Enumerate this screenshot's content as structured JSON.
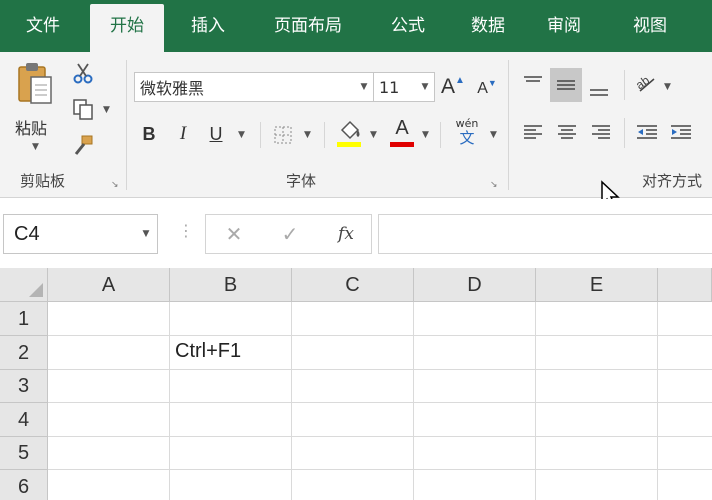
{
  "tabs": [
    "文件",
    "开始",
    "插入",
    "页面布局",
    "公式",
    "数据",
    "审阅",
    "视图"
  ],
  "active_tab": "开始",
  "clipboard": {
    "paste_label": "粘贴",
    "group_label": "剪贴板"
  },
  "font": {
    "name": "微软雅黑",
    "size": "11",
    "grow": "A",
    "shrink": "A",
    "bold": "B",
    "italic": "I",
    "underline": "U",
    "font_color_glyph": "A",
    "phonetic_top": "wén",
    "phonetic_bottom": "文",
    "group_label": "字体",
    "highlight_color": "#ffff00",
    "font_color": "#e00000"
  },
  "alignment": {
    "group_label": "对齐方式"
  },
  "formula_bar": {
    "name_box": "C4",
    "cancel": "✕",
    "enter": "✓",
    "fx": "fx",
    "value": ""
  },
  "sheet": {
    "columns": [
      "A",
      "B",
      "C",
      "D",
      "E"
    ],
    "rows": [
      "1",
      "2",
      "3",
      "4",
      "5",
      "6"
    ],
    "cells": {
      "B2": "Ctrl+F1"
    }
  },
  "colors": {
    "brand": "#217346",
    "ribbon_bg": "#f3f3f3"
  }
}
